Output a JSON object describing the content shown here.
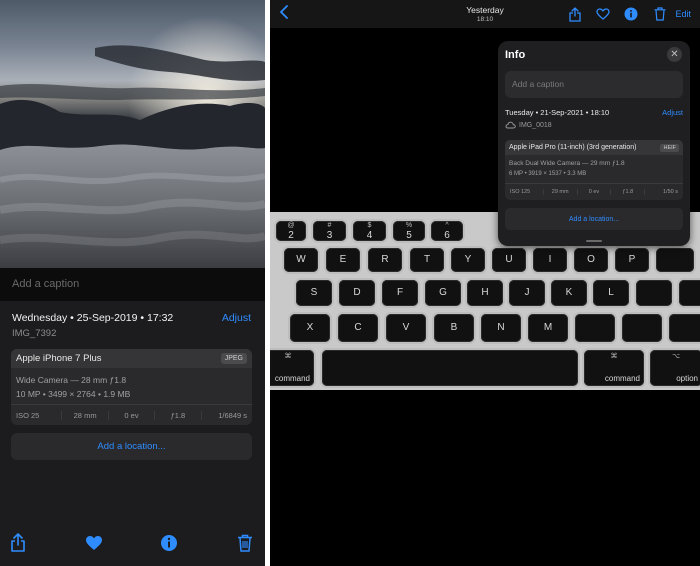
{
  "left": {
    "caption_placeholder": "Add a caption",
    "date": "Wednesday • 25-Sep-2019 • 17:32",
    "adjust": "Adjust",
    "filename": "IMG_7392",
    "device": "Apple iPhone 7 Plus",
    "format_badge": "JPEG",
    "lens": "Wide Camera — 28 mm ƒ1.8",
    "meta": "10 MP  •  3499 × 2764  •  1.9 MB",
    "exif": [
      "ISO 25",
      "28 mm",
      "0 ev",
      "ƒ1.8",
      "1/6849 s"
    ],
    "add_location": "Add a location...",
    "toolbar": [
      "share-icon",
      "heart-icon",
      "info-icon",
      "trash-icon"
    ]
  },
  "right": {
    "header": {
      "title": "Yesterday",
      "subtitle": "18:10",
      "edit": "Edit"
    },
    "keyboard": {
      "row1": [
        [
          "@",
          "2"
        ],
        [
          "#",
          "3"
        ],
        [
          "$",
          "4"
        ],
        [
          "%",
          "5"
        ],
        [
          "^",
          "6"
        ]
      ],
      "row2": [
        "W",
        "E",
        "R",
        "T",
        "Y",
        "U",
        "I",
        "O",
        "P"
      ],
      "row3": [
        "S",
        "D",
        "F",
        "G",
        "H",
        "J",
        "K",
        "L"
      ],
      "row4": [
        "X",
        "C",
        "V",
        "B",
        "N",
        "M"
      ],
      "command_left": "command",
      "command_right": "command",
      "option": "option",
      "cmd_symbol": "⌘",
      "opt_symbol": "⌥"
    },
    "info": {
      "title": "Info",
      "caption_placeholder": "Add a caption",
      "date": "Tuesday • 21-Sep-2021 • 18:10",
      "adjust": "Adjust",
      "filename": "IMG_0018",
      "device": "Apple iPad Pro (11-inch) (3rd generation)",
      "format_badge": "HEIF",
      "lens": "Back Dual Wide Camera — 29 mm ƒ1.8",
      "meta": "6 MP  •  3919 × 1537  •  3.3 MB",
      "exif": [
        "ISO 125",
        "29 mm",
        "0 ev",
        "ƒ1.8",
        "1/50 s"
      ],
      "add_location": "Add a location..."
    }
  },
  "colors": {
    "accent": "#2f8cff",
    "panel": "#1c1c1e",
    "card": "#2a2a2c"
  }
}
